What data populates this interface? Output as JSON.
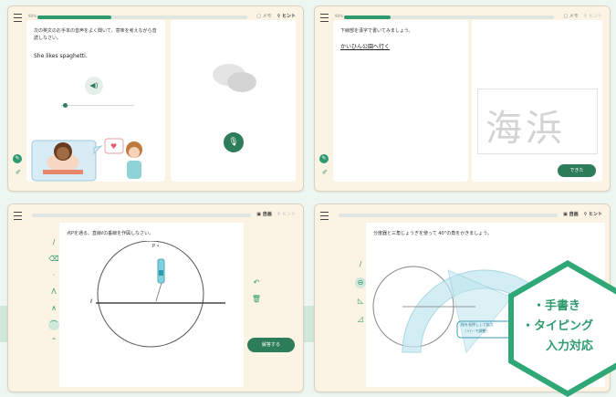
{
  "panel1": {
    "prog_label": "90%",
    "progress": 0.35,
    "hint": "ヒント",
    "note": "メモ",
    "question": "次の英文のお手本の音声をよく聞いて、意味を考えながら音読しなさい。",
    "sentence": "She likes spaghetti.",
    "speaker_icon": "speaker-icon",
    "mic_icon": "microphone-icon"
  },
  "panel2": {
    "prog_label": "90%",
    "progress": 0.22,
    "hint": "ヒント",
    "note": "メモ",
    "question": "下線部を漢字で書いてみましょう。",
    "answer_line": "かいひん公園へ行く",
    "kanji_model": "海浜",
    "done_label": "できた"
  },
  "panel3": {
    "note": "自画",
    "hint": "ヒント",
    "question": "点Pを通る、直線ℓの垂線を作図しなさい。",
    "point_label": "P •",
    "line_label": "ℓ",
    "submit_label": "解答する"
  },
  "panel4": {
    "note": "自画",
    "hint": "ヒント",
    "question": "分度器と三角じょうぎを使って 40°の角をかきましょう。",
    "protractor_text": "指を長押しして拡大",
    "protractor_sub": "（＋/－で調整）"
  },
  "badge": {
    "line1": "・手書き",
    "line2": "・タイピング",
    "line3": "入力対応"
  }
}
